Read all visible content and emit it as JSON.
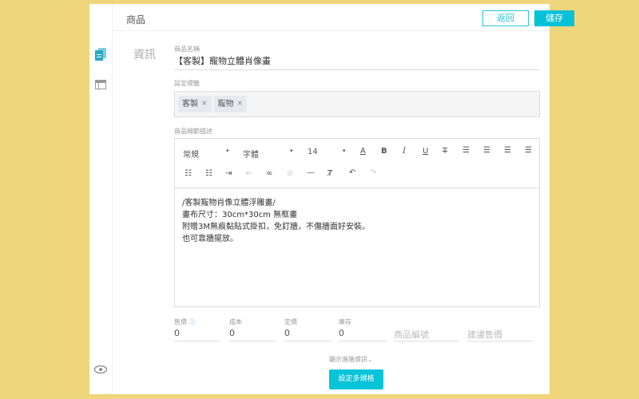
{
  "header": {
    "title": "商品",
    "back_label": "返回",
    "save_label": "儲存"
  },
  "section_title": "資訊",
  "product_name": {
    "label": "商品名稱",
    "value": "【客製】寵物立體肖像畫"
  },
  "tags": {
    "label": "設定標籤",
    "items": [
      "客製",
      "寵物"
    ],
    "remove_glyph": "×"
  },
  "description": {
    "label": "商品細節描述",
    "toolbar": {
      "format": "常規",
      "font": "字體",
      "size": "14"
    },
    "lines": [
      "/客製寵物肖像立體浮雕畫/",
      "畫布尺寸：30cm*30cm 無框畫",
      "附贈3M無痕黏貼式掛扣，免釘牆，不傷牆面好安裝。",
      "也可靠牆擺放。"
    ]
  },
  "pricing": {
    "price": {
      "label": "售價",
      "value": "0"
    },
    "cost": {
      "label": "成本",
      "value": "0"
    },
    "list_price": {
      "label": "定價",
      "value": "0"
    },
    "stock": {
      "label": "庫存",
      "value": "0"
    },
    "sku_placeholder": "商品編號",
    "suggested_placeholder": "建議售價"
  },
  "advanced_label": "顯示進階資訊",
  "multi_spec_label": "設定多規格",
  "colors": {
    "accent": "#06c1d8",
    "background": "#efd57b"
  }
}
